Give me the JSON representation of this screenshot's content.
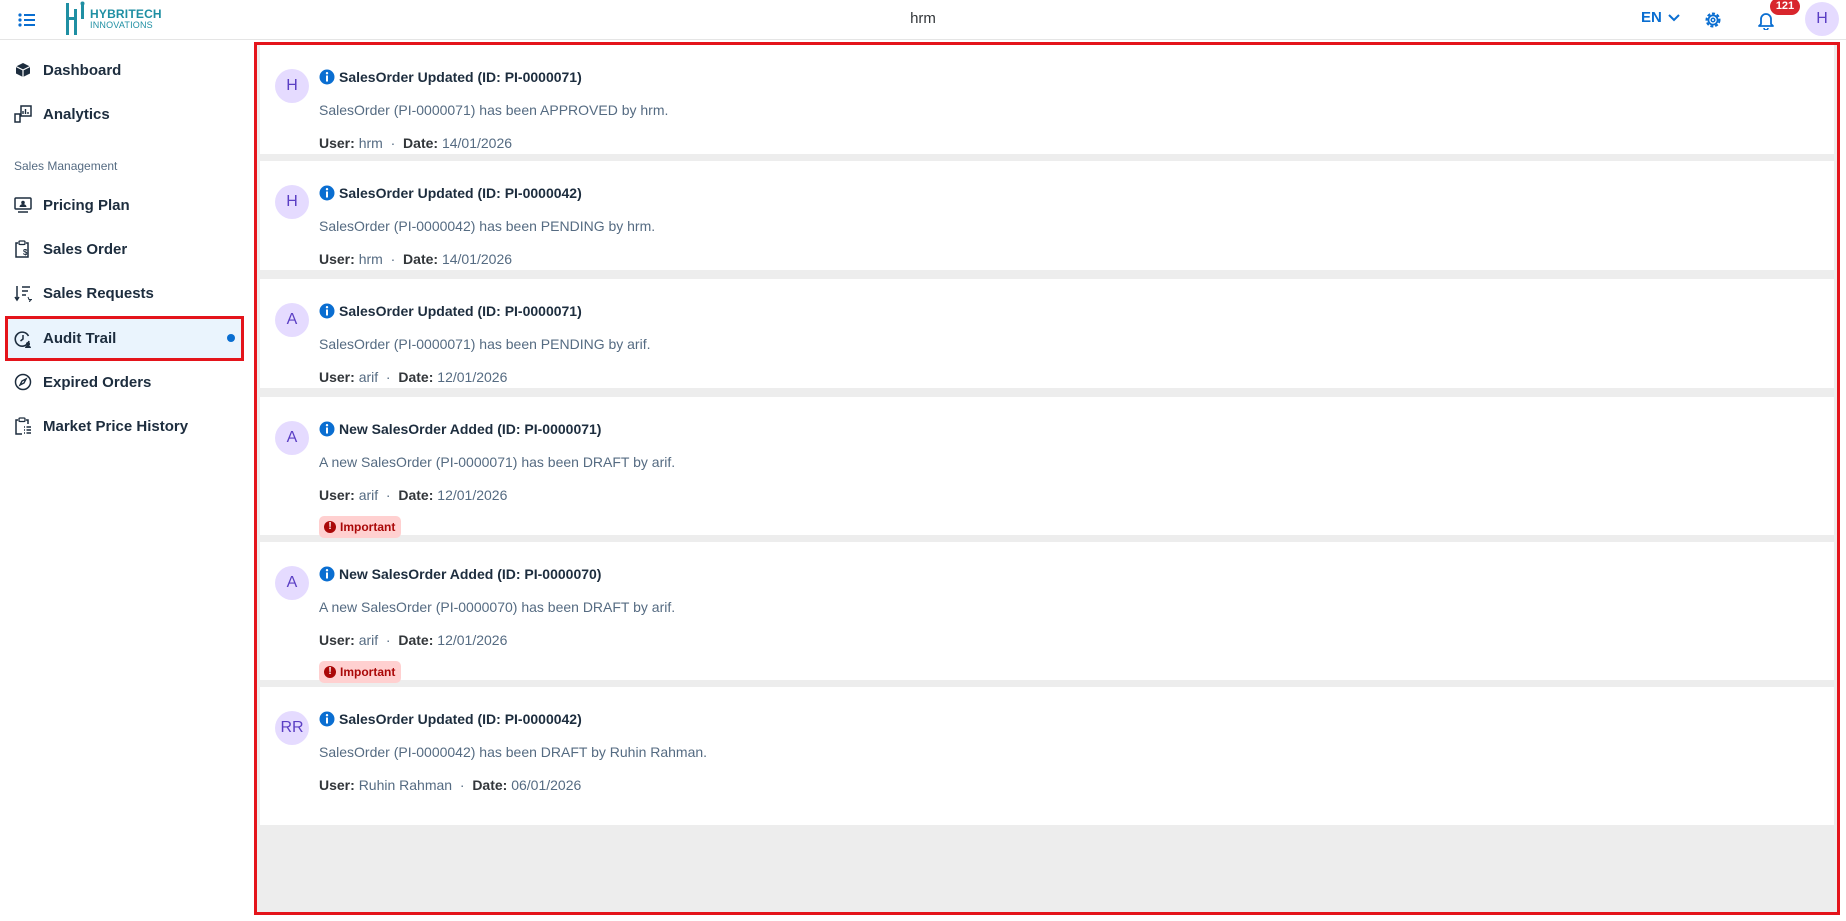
{
  "header": {
    "logo_line1": "HYBRITECH",
    "logo_line2": "INNOVATIONS",
    "title": "hrm",
    "language": "EN",
    "notification_count": "121",
    "user_initial": "H"
  },
  "sidebar": {
    "items_top": [
      {
        "label": "Dashboard",
        "icon": "cube-icon"
      },
      {
        "label": "Analytics",
        "icon": "analytics-icon"
      }
    ],
    "section_label": "Sales Management",
    "items": [
      {
        "label": "Pricing Plan",
        "icon": "presentation-icon"
      },
      {
        "label": "Sales Order",
        "icon": "clipboard-dollar-icon"
      },
      {
        "label": "Sales Requests",
        "icon": "sort-list-icon"
      },
      {
        "label": "Audit Trail",
        "icon": "history-icon",
        "active": true
      },
      {
        "label": "Expired Orders",
        "icon": "compass-icon"
      },
      {
        "label": "Market Price History",
        "icon": "clipboard-list-icon"
      }
    ]
  },
  "labels": {
    "user": "User:",
    "date": "Date:",
    "sep": "·",
    "important": "Important"
  },
  "audit_entries": [
    {
      "initials": "H",
      "title": "SalesOrder Updated (ID: PI-0000071)",
      "description": "SalesOrder (PI-0000071) has been APPROVED by hrm.",
      "user": "hrm",
      "date": "14/01/2026",
      "important": false
    },
    {
      "initials": "H",
      "title": "SalesOrder Updated (ID: PI-0000042)",
      "description": "SalesOrder (PI-0000042) has been PENDING by hrm.",
      "user": "hrm",
      "date": "14/01/2026",
      "important": false
    },
    {
      "initials": "A",
      "title": "SalesOrder Updated (ID: PI-0000071)",
      "description": "SalesOrder (PI-0000071) has been PENDING by arif.",
      "user": "arif",
      "date": "12/01/2026",
      "important": false
    },
    {
      "initials": "A",
      "title": "New SalesOrder Added (ID: PI-0000071)",
      "description": "A new SalesOrder (PI-0000071) has been DRAFT by arif.",
      "user": "arif",
      "date": "12/01/2026",
      "important": true
    },
    {
      "initials": "A",
      "title": "New SalesOrder Added (ID: PI-0000070)",
      "description": "A new SalesOrder (PI-0000070) has been DRAFT by arif.",
      "user": "arif",
      "date": "12/01/2026",
      "important": true
    },
    {
      "initials": "RR",
      "title": "SalesOrder Updated (ID: PI-0000042)",
      "description": "SalesOrder (PI-0000042) has been DRAFT by Ruhin Rahman.",
      "user": "Ruhin Rahman",
      "date": "06/01/2026",
      "important": false
    }
  ],
  "colors": {
    "accent": "#0a6ed1",
    "highlight_border": "#e4141b",
    "important_bg": "#ffd0d0",
    "important_text": "#aa0808",
    "avatar_bg": "#e5dbff"
  }
}
